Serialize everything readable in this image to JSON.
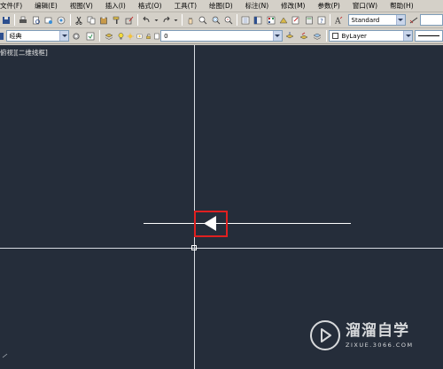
{
  "menubar": {
    "items": [
      "文件(F)",
      "编辑(E)",
      "视图(V)",
      "插入(I)",
      "格式(O)",
      "工具(T)",
      "绘图(D)",
      "标注(N)",
      "修改(M)",
      "参数(P)",
      "窗口(W)",
      "帮助(H)"
    ]
  },
  "toolbar1": {
    "text_style_value": "Standard"
  },
  "toolbar2": {
    "workspace_value": "经典",
    "layer_value": "0",
    "color_value": "ByLayer"
  },
  "canvas": {
    "viewport_label": "俯视][二维线框]",
    "background_color": "#252d3a",
    "highlight_color": "#e02020"
  },
  "watermark": {
    "title": "溜溜自学",
    "subtitle": "ZIXUE.3066.COM"
  }
}
